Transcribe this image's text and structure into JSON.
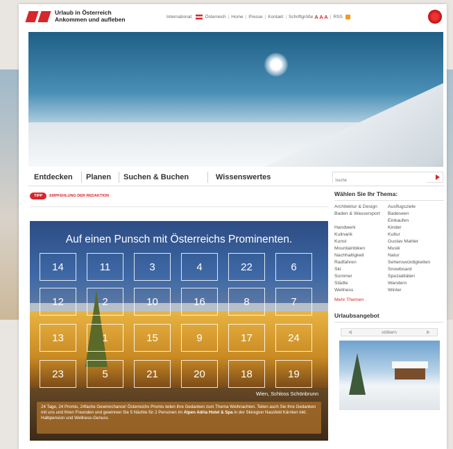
{
  "header": {
    "logo_line1": "Urlaub in Österreich",
    "logo_line2": "Ankommen und aufleben",
    "topnav": {
      "international": "International:",
      "oesterreich": "Österreich",
      "home": "Home",
      "presse": "Presse",
      "kontakt": "Kontakt",
      "schriftgroesse": "Schriftgröße",
      "aaa": "A A A",
      "rss": "RSS"
    }
  },
  "mainnav": {
    "entdecken": "Entdecken",
    "planen": "Planen",
    "suchen_buchen": "Suchen & Buchen",
    "wissenswertes": "Wissenswertes",
    "search_placeholder": "Suche"
  },
  "tip": {
    "badge": "TIPP",
    "label": "EMPFEHLUNG DER REDAKTION"
  },
  "promo": {
    "title": "Auf einen Punsch mit Österreichs Prominenten.",
    "doors": [
      "14",
      "11",
      "3",
      "4",
      "22",
      "6",
      "12",
      "2",
      "10",
      "16",
      "8",
      "7",
      "13",
      "1",
      "15",
      "9",
      "17",
      "24",
      "23",
      "5",
      "21",
      "20",
      "18",
      "19"
    ],
    "caption": "Wien, Schloss Schönbrunn",
    "desc_part1": "24 Tage, 24 Promis, 24fache Gewinnchance! Österreichs Promis teilen ihre Gedanken zum Thema Weihnachten. Teilen auch Sie Ihre Gedanken mit uns und Ihren Freunden und gewinnen Sie 5 Nächte für 2 Personen im ",
    "desc_bold": "Alpen Adria Hotel & Spa",
    "desc_part2": " in der Skiregion Nassfeld Kärnten inkl. Halbpension und Wellness-Genuss."
  },
  "sidebar": {
    "title": "Wählen Sie Ihr Thema:",
    "themes": [
      "Architektur & Design",
      "Ausflugsziele",
      "Baden & Wassersport",
      "Badeseen",
      "",
      "Einkaufen",
      "Handwerk",
      "Kinder",
      "Kulinarik",
      "Kultur",
      "Kunst",
      "Gustav Mahler",
      "Mountainbiken",
      "Musik",
      "Nachhaltigkeit",
      "Natur",
      "Radfahren",
      "Sehenswürdigkeiten",
      "Ski",
      "Snowboard",
      "Sommer",
      "Spezialitäten",
      "Städte",
      "Wandern",
      "Wellness",
      "Winter"
    ],
    "more": "Mehr Themen",
    "urlaubsangebot": "Urlaubsangebot",
    "pager_label": "stöbern"
  }
}
